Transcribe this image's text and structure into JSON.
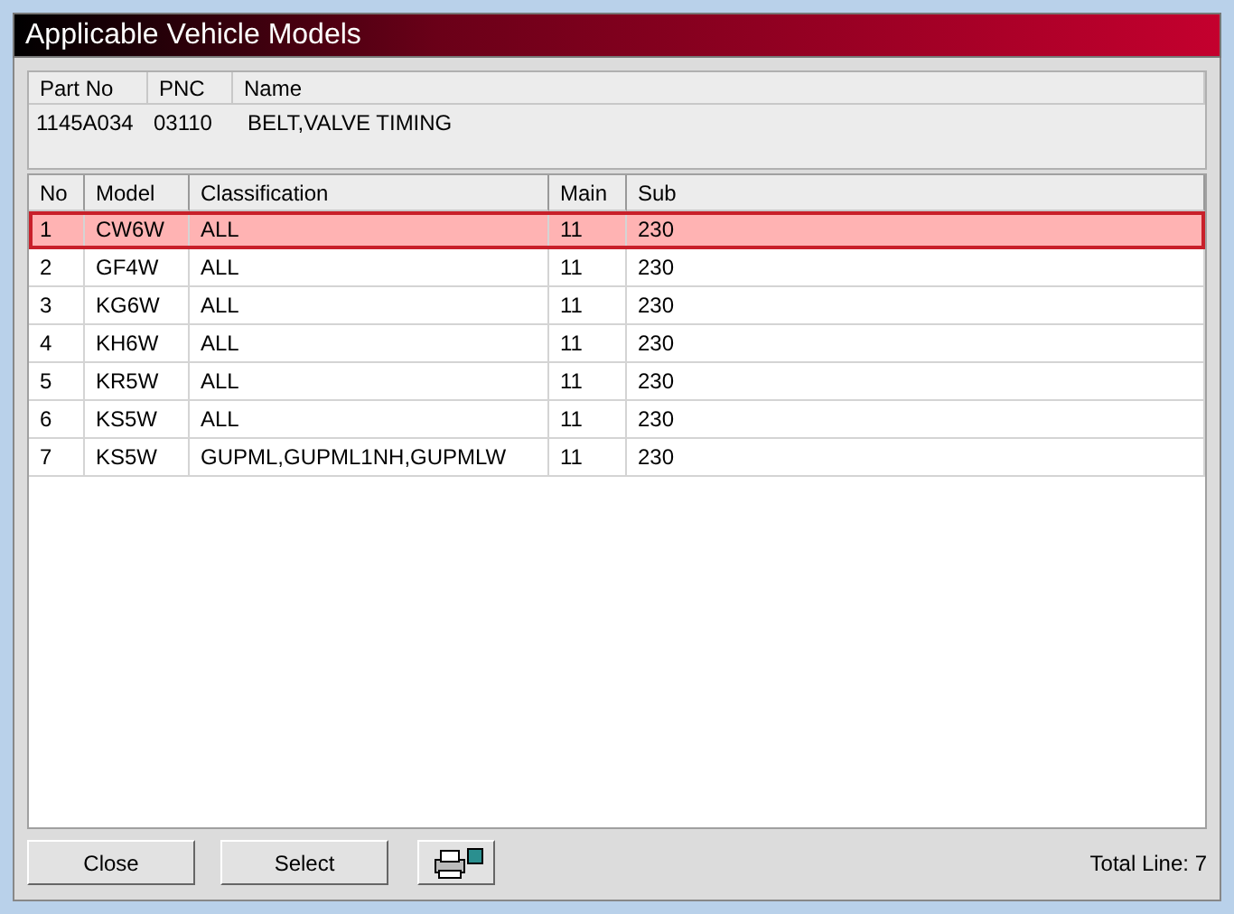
{
  "window": {
    "title": "Applicable Vehicle Models"
  },
  "part": {
    "columns": [
      "Part No",
      "PNC",
      "Name"
    ],
    "values": [
      "1145A034",
      "03110",
      "BELT,VALVE TIMING"
    ]
  },
  "table": {
    "columns": [
      "No",
      "Model",
      "Classification",
      "Main",
      "Sub"
    ],
    "rows": [
      {
        "cells": [
          "1",
          "CW6W",
          "ALL",
          "11",
          "230"
        ],
        "selected": true
      },
      {
        "cells": [
          "2",
          "GF4W",
          "ALL",
          "11",
          "230"
        ],
        "selected": false
      },
      {
        "cells": [
          "3",
          "KG6W",
          "ALL",
          "11",
          "230"
        ],
        "selected": false
      },
      {
        "cells": [
          "4",
          "KH6W",
          "ALL",
          "11",
          "230"
        ],
        "selected": false
      },
      {
        "cells": [
          "5",
          "KR5W",
          "ALL",
          "11",
          "230"
        ],
        "selected": false
      },
      {
        "cells": [
          "6",
          "KS5W",
          "ALL",
          "11",
          "230"
        ],
        "selected": false
      },
      {
        "cells": [
          "7",
          "KS5W",
          "GUPML,GUPML1NH,GUPMLW",
          "11",
          "230"
        ],
        "selected": false
      }
    ]
  },
  "buttons": [
    "Close",
    "Select"
  ],
  "status": "Total Line: 7"
}
